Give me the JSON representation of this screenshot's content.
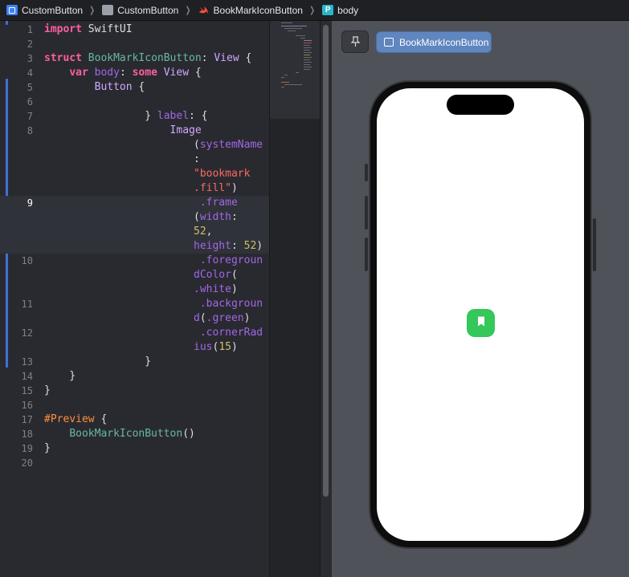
{
  "breadcrumb": {
    "items": [
      {
        "label": "CustomButton",
        "icon": "xcode-project-icon"
      },
      {
        "label": "CustomButton",
        "icon": "folder-icon"
      },
      {
        "label": "BookMarkIconButton",
        "icon": "swift-file-icon"
      },
      {
        "label": "body",
        "icon": "property-icon"
      }
    ],
    "property_badge": "P"
  },
  "editor": {
    "lines": [
      {
        "n": "1",
        "code": "import SwiftUI"
      },
      {
        "n": "2",
        "code": ""
      },
      {
        "n": "3",
        "code": "struct BookMarkIconButton: View {"
      },
      {
        "n": "4",
        "code": "    var body: some View {"
      },
      {
        "n": "5",
        "code": "        Button {"
      },
      {
        "n": "6",
        "code": ""
      },
      {
        "n": "7",
        "code": "        } label: {"
      },
      {
        "n": "8",
        "code": "            Image"
      },
      {
        "n": "",
        "code": "(systemName"
      },
      {
        "n": "",
        "code": ":"
      },
      {
        "n": "",
        "code": "\"bookmark"
      },
      {
        "n": "",
        "code": ".fill\")"
      },
      {
        "n": "9",
        "code": ".frame"
      },
      {
        "n": "",
        "code": "(width:"
      },
      {
        "n": "",
        "code": "52,"
      },
      {
        "n": "",
        "code": "height: 52)"
      },
      {
        "n": "10",
        "code": ".foregroun"
      },
      {
        "n": "",
        "code": "dColor("
      },
      {
        "n": "",
        "code": ".white)"
      },
      {
        "n": "11",
        "code": ".backgroun"
      },
      {
        "n": "",
        "code": "d(.green)"
      },
      {
        "n": "12",
        "code": ".cornerRad"
      },
      {
        "n": "",
        "code": "ius(15)"
      },
      {
        "n": "13",
        "code": "        }"
      },
      {
        "n": "14",
        "code": "    }"
      },
      {
        "n": "15",
        "code": "}"
      },
      {
        "n": "16",
        "code": ""
      },
      {
        "n": "17",
        "code": "#Preview {"
      },
      {
        "n": "18",
        "code": "    BookMarkIconButton()"
      },
      {
        "n": "19",
        "code": "}"
      },
      {
        "n": "20",
        "code": ""
      }
    ]
  },
  "canvas": {
    "pin_icon": "pin-icon",
    "preview_tab_label": "BookMarkIconButton",
    "preview_button_color": "#34c759",
    "preview_button_icon": "bookmark-fill-icon"
  },
  "colors": {
    "editor_bg": "#292a30",
    "keyword": "#fc5fa3",
    "type": "#d0a8ff",
    "string": "#fc6a5d",
    "number": "#d0bf69",
    "canvas_bg": "#4f5259",
    "accent": "#5f86bf"
  }
}
